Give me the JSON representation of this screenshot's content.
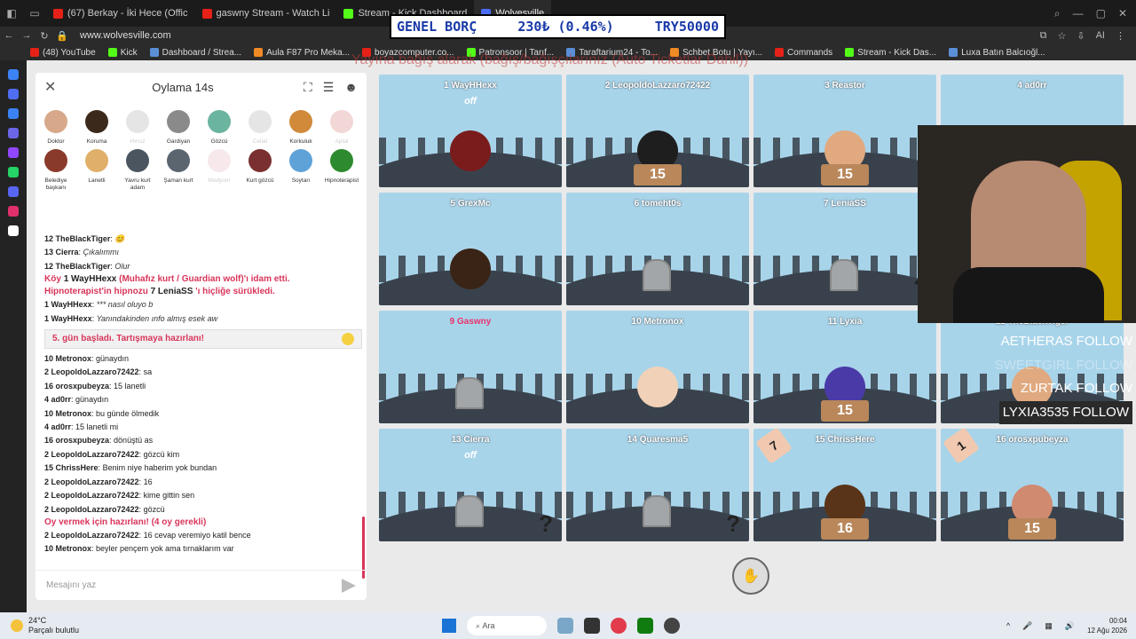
{
  "browser": {
    "tabs": [
      {
        "label": "(67) Berkay - İki Hece (Offic",
        "color": "#e62117"
      },
      {
        "label": "gaswny Stream - Watch Li",
        "color": "#e62117"
      },
      {
        "label": "Stream - Kick Dashboard",
        "color": "#53fc18"
      },
      {
        "label": "Wolvesville",
        "color": "#4a6cf7"
      }
    ],
    "url": "www.wolvesville.com",
    "bookmarks": [
      "(48) YouTube",
      "Kick",
      "Dashboard / Strea...",
      "Aula F87 Pro Meka...",
      "boyazcomputer.co...",
      "Patronsoor | Tarıf...",
      "Taraftarium24 - To...",
      "Schbet Botu | Yayı...",
      "Commands",
      "Stream - Kick Das...",
      "Luxa Batın Balcıoğl..."
    ]
  },
  "ticker": {
    "label": "GENEL BORÇ",
    "change": "230₺ (0.46%)",
    "total": "TRY50000"
  },
  "overlay_text": "Yayına bağış alarak (bağış/bağışçılarınız (Auto Ticketlar Dahil))",
  "panel": {
    "title": "Oylama 14s",
    "input_placeholder": "Mesajını yaz",
    "roles": [
      {
        "label": "Doktor",
        "color": "#d7a88a",
        "dim": false
      },
      {
        "label": "Koruma",
        "color": "#3b2a1c",
        "dim": false
      },
      {
        "label": "Hırsız",
        "color": "#999999",
        "dim": true
      },
      {
        "label": "Gardiyan",
        "color": "#8a8a8a",
        "dim": false
      },
      {
        "label": "Gözcü",
        "color": "#6bb4a0",
        "dim": false
      },
      {
        "label": "Cellat",
        "color": "#999999",
        "dim": true
      },
      {
        "label": "Korkuluk",
        "color": "#d08a3a",
        "dim": false
      },
      {
        "label": "Aptal",
        "color": "#c9645f",
        "dim": true
      },
      {
        "label": "Belediye başkanı",
        "color": "#8a3a2a",
        "dim": false
      },
      {
        "label": "Lanetli",
        "color": "#e0b06a",
        "dim": false
      },
      {
        "label": "Yavru kurt adam",
        "color": "#4a5560",
        "dim": false
      },
      {
        "label": "Şaman kurt",
        "color": "#5a6570",
        "dim": false
      },
      {
        "label": "Medyum",
        "color": "#e3a6b6",
        "dim": true
      },
      {
        "label": "Kurt gözcü",
        "color": "#7a3030",
        "dim": false
      },
      {
        "label": "Soytarı",
        "color": "#5fa2d8",
        "dim": false
      },
      {
        "label": "Hipnoterapist",
        "color": "#2e8a2e",
        "dim": false
      }
    ],
    "messages": [
      {
        "type": "line",
        "name": "12 TheBlackTiger",
        "text": "😊",
        "italic": true
      },
      {
        "type": "line",
        "name": "13 Cierra",
        "text": "Çıkalımmı",
        "italic": true
      },
      {
        "type": "line",
        "name": "12 TheBlackTiger",
        "text": "Olur",
        "italic": true
      },
      {
        "type": "red",
        "pre": "Köy",
        "name": "1 WayHHexx",
        "text": "(Muhafız kurt / Guardian wolf)'ı idam etti."
      },
      {
        "type": "red",
        "pre": "Hipnoterapist'in hipnozu",
        "name": "7 LeniaSS",
        "text": "'ı hiçliğe sürükledi."
      },
      {
        "type": "line",
        "name": "1 WayHHexx",
        "text": "*** nasıl oluyo b",
        "italic": true
      },
      {
        "type": "line",
        "name": "1 WayHHexx",
        "text": "Yanındakinden ınfo almış esek aw",
        "italic": true
      },
      {
        "type": "banner",
        "text": "5. gün başladı. Tartışmaya hazırlanı!"
      },
      {
        "type": "line",
        "name": "10 Metronox",
        "text": "günaydın",
        "italic": false
      },
      {
        "type": "line",
        "name": "2 LeopoldoLazzaro72422",
        "text": "sa",
        "italic": false
      },
      {
        "type": "line",
        "name": "16 orosxpubeyza",
        "text": "15 lanetli",
        "italic": false
      },
      {
        "type": "line",
        "name": "4 ad0rr",
        "text": "günaydın",
        "italic": false
      },
      {
        "type": "line",
        "name": "10 Metronox",
        "text": "bu günde ölmedik",
        "italic": false
      },
      {
        "type": "line",
        "name": "4 ad0rr",
        "text": "15 lanetli mi",
        "italic": false
      },
      {
        "type": "line",
        "name": "16 orosxpubeyza",
        "text": "dönüştü as",
        "italic": false
      },
      {
        "type": "line",
        "name": "2 LeopoldoLazzaro72422",
        "text": "gözcü kim",
        "italic": false
      },
      {
        "type": "line",
        "name": "15 ChrissHere",
        "text": "Benim niye haberim yok bundan",
        "italic": false
      },
      {
        "type": "line",
        "name": "2 LeopoldoLazzaro72422",
        "text": "16",
        "italic": false
      },
      {
        "type": "line",
        "name": "2 LeopoldoLazzaro72422",
        "text": "kime gittin sen",
        "italic": false
      },
      {
        "type": "line",
        "name": "2 LeopoldoLazzaro72422",
        "text": "gözcü",
        "italic": false
      },
      {
        "type": "redsys",
        "text": "Oy vermek için hazırlanı! (4 oy gerekli)"
      },
      {
        "type": "line",
        "name": "2 LeopoldoLazzaro72422",
        "text": "16 cevap veremiyo katil bence",
        "italic": false
      },
      {
        "type": "line",
        "name": "10 Metronox",
        "text": "beyler pençem yok ama tırnaklarım var",
        "italic": false
      }
    ]
  },
  "players": [
    {
      "name": "1 WayHHexx",
      "sub": "off",
      "state": "alive",
      "avatar": "#7a1c1c"
    },
    {
      "name": "2 LeopoldoLazzaro72422",
      "sign": "15",
      "state": "alive",
      "avatar": "#1e1e1e"
    },
    {
      "name": "3 Reastor",
      "sign": "15",
      "state": "alive",
      "avatar": "#e0a97f"
    },
    {
      "name": "4 ad0rr",
      "state": "alive",
      "avatar": "#e0a97f"
    },
    {
      "name": "5 GrexMc",
      "state": "alive",
      "avatar": "#3a2416"
    },
    {
      "name": "6 tomeht0s",
      "state": "dead"
    },
    {
      "name": "7 LeniaSS",
      "state": "dead",
      "q": "?"
    },
    {
      "name": "8 TheBlackTiger",
      "state": "alive",
      "avatar": "#e0a97f"
    },
    {
      "name": "9 Gaswny",
      "state": "dead",
      "dead_name": true
    },
    {
      "name": "10 Metronox",
      "state": "alive",
      "avatar": "#f1d2b8"
    },
    {
      "name": "11 Lyxia",
      "sign": "15",
      "state": "alive",
      "avatar": "#4a3aa8"
    },
    {
      "name": "12 TheBlackTiger",
      "state": "alive",
      "avatar": "#e0a97f"
    },
    {
      "name": "13 Cierra",
      "sub": "off",
      "state": "dead",
      "q": "?"
    },
    {
      "name": "14 Quaresma5",
      "state": "dead",
      "q": "?"
    },
    {
      "name": "15 ChrissHere",
      "sign": "16",
      "vote": "7",
      "state": "alive",
      "avatar": "#5a3418"
    },
    {
      "name": "16 orosxpubeyza",
      "sign": "15",
      "vote": "1",
      "state": "alive",
      "avatar": "#d08a70"
    }
  ],
  "follows": [
    {
      "text": "AETHERAS FOLLOW",
      "style": "plain"
    },
    {
      "text": "SWEETGIRL FOLLOW",
      "style": "faint"
    },
    {
      "text": "ZURTAK FOLLOW",
      "style": "plain"
    },
    {
      "text": "LYXIA3535 FOLLOW",
      "style": "hl"
    }
  ],
  "taskbar": {
    "weather_temp": "24°C",
    "weather_desc": "Parçalı bulutlu",
    "search": "Ara",
    "time": "00:04",
    "date": "12 Ağu 2026"
  }
}
